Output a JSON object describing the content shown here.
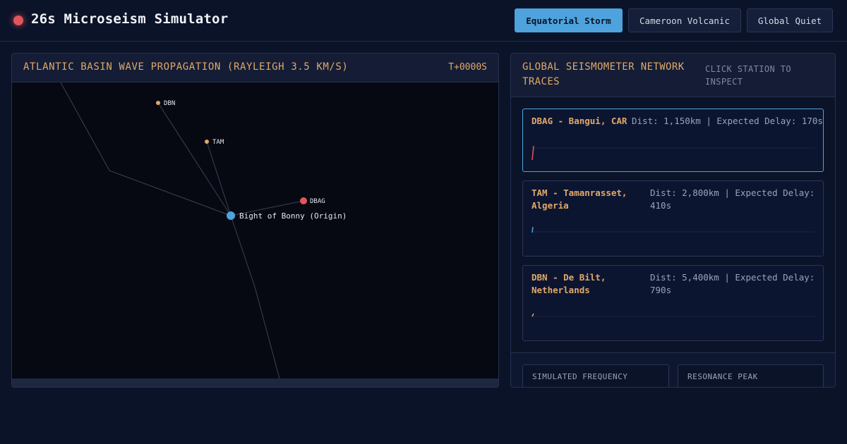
{
  "app": {
    "title": "26s Microseism Simulator"
  },
  "scenarios": {
    "items": [
      {
        "label": "Equatorial Storm",
        "active": true
      },
      {
        "label": "Cameroon Volcanic",
        "active": false
      },
      {
        "label": "Global Quiet",
        "active": false
      }
    ]
  },
  "map_panel": {
    "title": "ATLANTIC BASIN WAVE PROPAGATION (RAYLEIGH 3.5 KM/S)",
    "time": "T+0000S",
    "origin_label": "Bight of Bonny (Origin)",
    "stations": [
      {
        "code": "DBN",
        "color": "#e1a86a"
      },
      {
        "code": "TAM",
        "color": "#e1a86a"
      },
      {
        "code": "DBAG",
        "color": "#e2555e"
      }
    ],
    "origin_color": "#4ea3dd"
  },
  "network_panel": {
    "title": "GLOBAL SEISMOMETER NETWORK TRACES",
    "hint": "CLICK STATION TO INSPECT",
    "traces": [
      {
        "name": "DBAG - Bangui, CAR",
        "meta": "Dist: 1,150km | Expected Delay: 170s",
        "selected": true,
        "color": "#e2555e"
      },
      {
        "name": "TAM - Tamanrasset, Algeria",
        "meta": "Dist: 2,800km | Expected Delay: 410s",
        "selected": false,
        "color": "#4ea3dd"
      },
      {
        "name": "DBN - De Bilt, Netherlands",
        "meta": "Dist: 5,400km | Expected Delay: 790s",
        "selected": false,
        "color": "#e1a86a"
      }
    ],
    "stats": [
      {
        "label": "SIMULATED FREQUENCY"
      },
      {
        "label": "RESONANCE PEAK"
      }
    ]
  }
}
